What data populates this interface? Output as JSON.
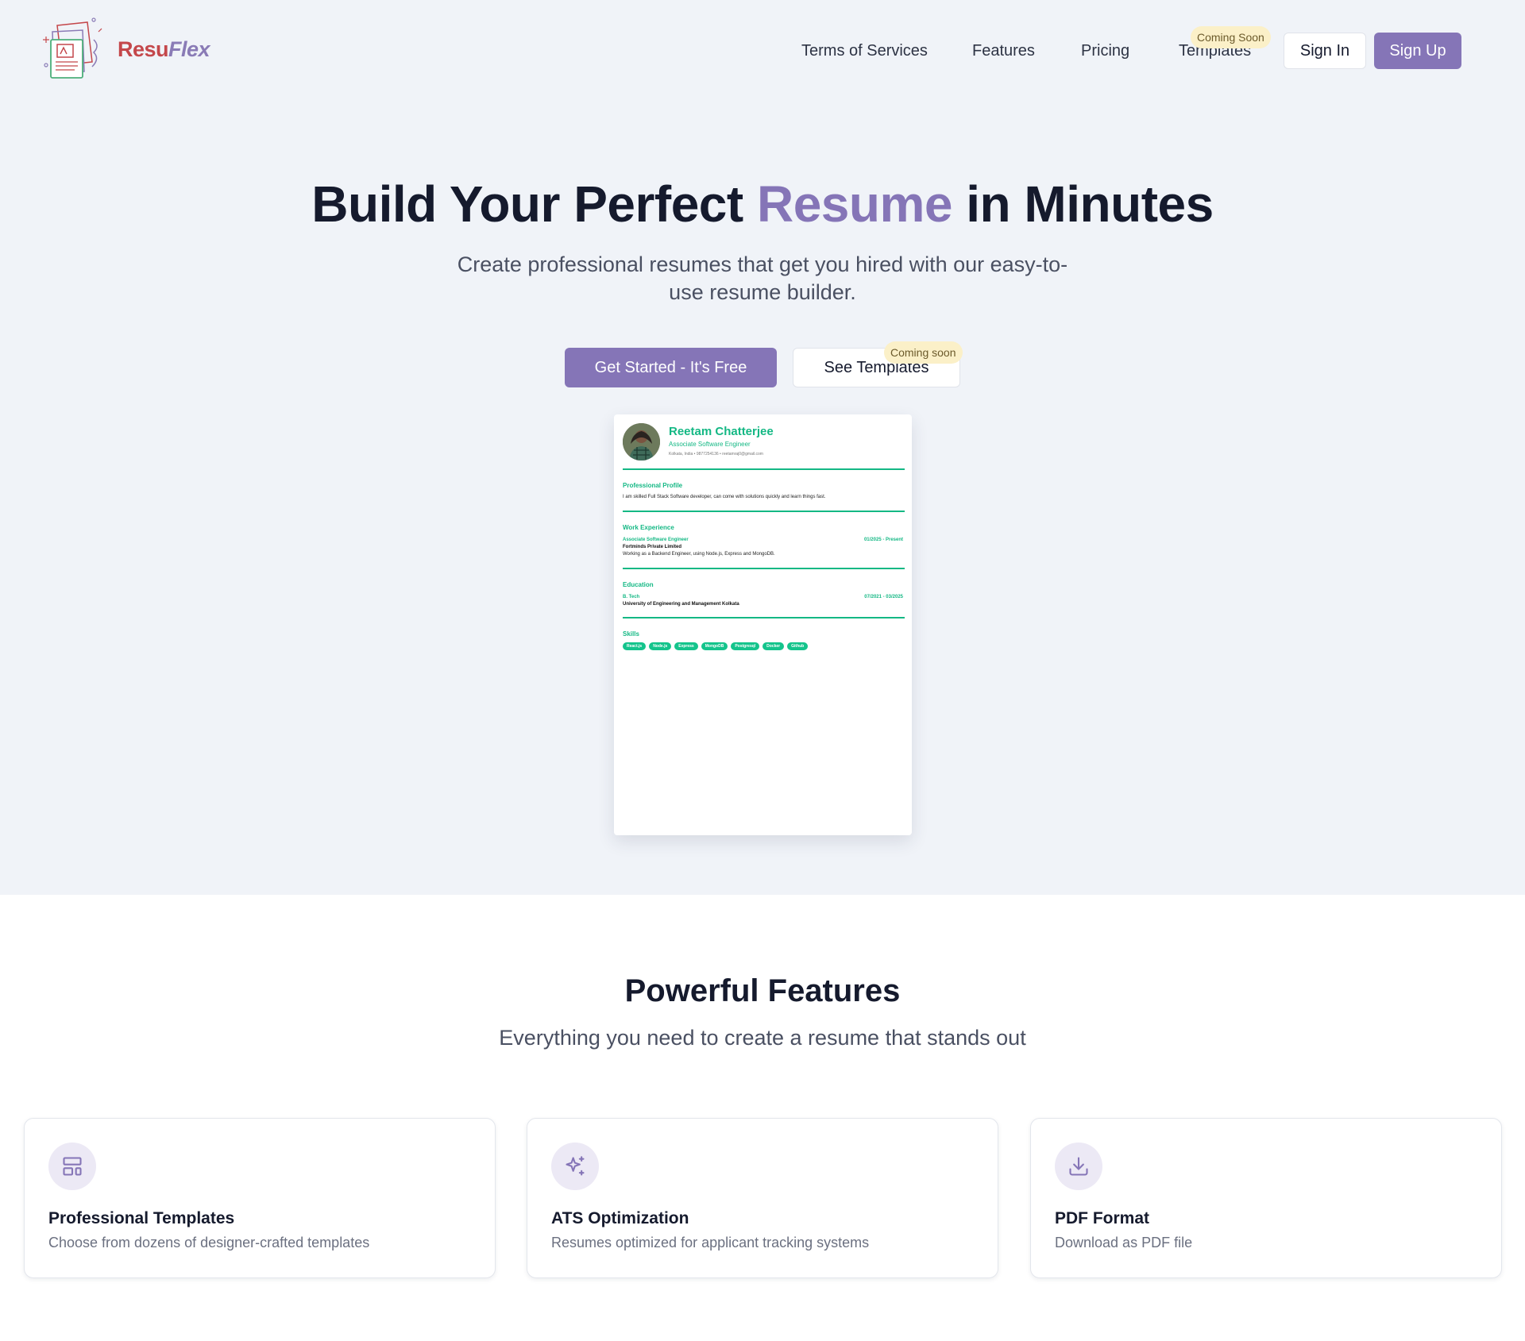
{
  "colors": {
    "accent": "#8575b7",
    "resume_green": "#14b884",
    "hero_bg": "#f0f3f8",
    "badge_bg": "#fbf0c8"
  },
  "brand": {
    "part1": "Resu",
    "part2": "Flex"
  },
  "nav": {
    "terms": "Terms of Services",
    "features": "Features",
    "pricing": "Pricing",
    "templates": "Templates",
    "templates_badge": "Coming Soon",
    "sign_in": "Sign In",
    "sign_up": "Sign Up"
  },
  "hero": {
    "title_before": "Build Your Perfect",
    "title_accent": "Resume",
    "title_after": "in Minutes",
    "subtitle_line1": "Create professional resumes that get you hired with our easy-to-",
    "subtitle_line2": "use resume builder.",
    "cta_primary": "Get Started - It's Free",
    "cta_secondary": "See Templates",
    "cta_secondary_badge": "Coming soon"
  },
  "resume": {
    "name": "Reetam Chatterjee",
    "role": "Associate Software Engineer",
    "contact": "Kolkata, India • 9877254136 • reetamraj0@gmail.com",
    "profile_heading": "Professional Profile",
    "profile_text": "I am skilled Full Stack Software developer, can come with solutions quickly and learn things fast.",
    "work_heading": "Work Experience",
    "work_title": "Associate Software Engineer",
    "work_dates": "01/2025 - Present",
    "work_company": "Fortminds Private Limited",
    "work_desc": "Working as a Backend Engineer, using Node.js, Express and MongoDB.",
    "edu_heading": "Education",
    "edu_degree": "B. Tech",
    "edu_dates": "07/2021 - 03/2025",
    "edu_school": "University of Engineering and Management Kolkata",
    "skills_heading": "Skills",
    "skills": [
      "React.js",
      "Node.js",
      "Express",
      "MongoDB",
      "Postgresql",
      "Docker",
      "Github"
    ]
  },
  "features": {
    "title": "Powerful Features",
    "subtitle": "Everything you need to create a resume that stands out",
    "cards": [
      {
        "icon": "layout-template-icon",
        "title": "Professional Templates",
        "desc": "Choose from dozens of designer-crafted templates"
      },
      {
        "icon": "sparkles-icon",
        "title": "ATS Optimization",
        "desc": "Resumes optimized for applicant tracking systems"
      },
      {
        "icon": "download-icon",
        "title": "PDF Format",
        "desc": "Download as PDF file"
      }
    ]
  }
}
